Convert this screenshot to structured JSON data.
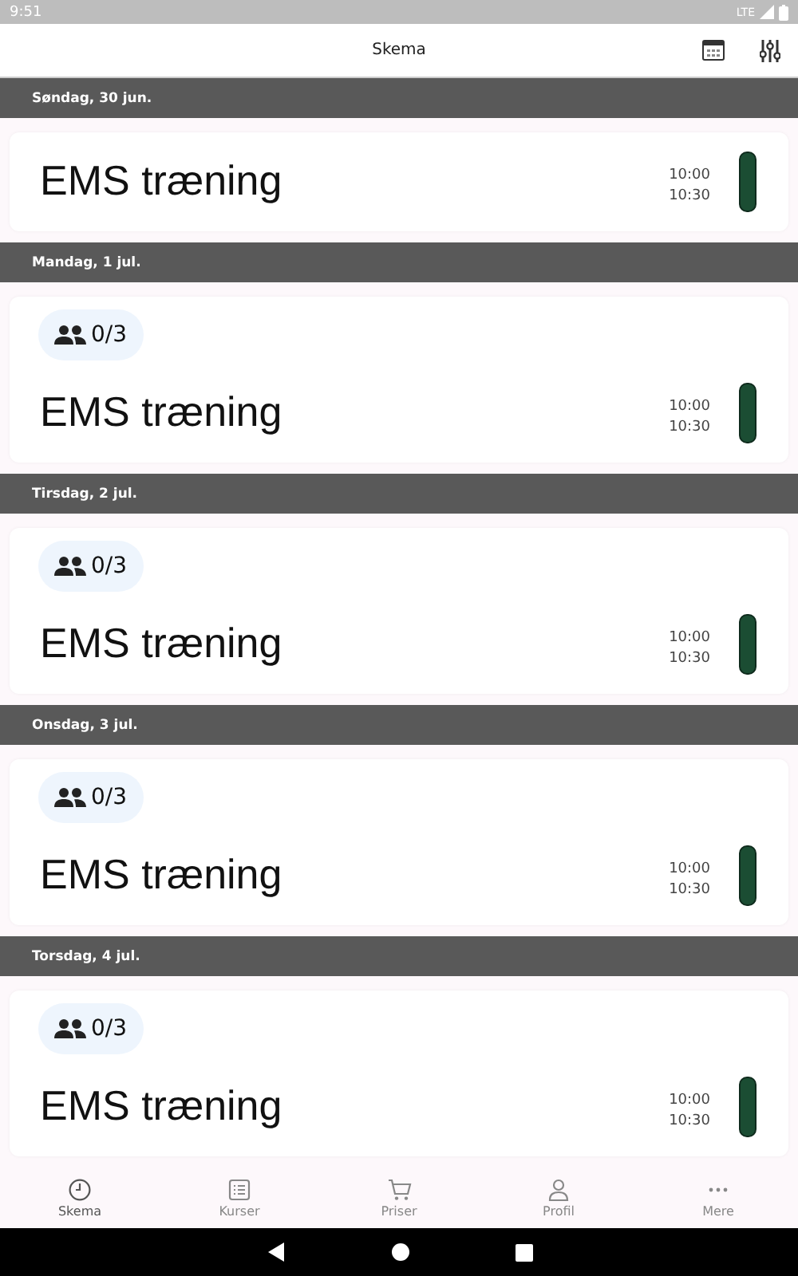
{
  "status_bar": {
    "time": "9:51",
    "network": "LTE"
  },
  "app_bar": {
    "title": "Skema"
  },
  "days": [
    {
      "date": "Søndag, 30 jun.",
      "events": [
        {
          "title": "EMS træning",
          "start": "10:00",
          "end": "10:30"
        }
      ]
    },
    {
      "date": "Mandag, 1 jul.",
      "events": [
        {
          "title": "EMS træning",
          "start": "10:00",
          "end": "10:30",
          "participants": "0/3"
        }
      ]
    },
    {
      "date": "Tirsdag, 2 jul.",
      "events": [
        {
          "title": "EMS træning",
          "start": "10:00",
          "end": "10:30",
          "participants": "0/3"
        }
      ]
    },
    {
      "date": "Onsdag, 3 jul.",
      "events": [
        {
          "title": "EMS træning",
          "start": "10:00",
          "end": "10:30",
          "participants": "0/3"
        }
      ]
    },
    {
      "date": "Torsdag, 4 jul.",
      "events": [
        {
          "title": "EMS træning",
          "start": "10:00",
          "end": "10:30",
          "participants": "0/3"
        }
      ]
    }
  ],
  "bottom_nav": [
    {
      "label": "Skema",
      "selected": true
    },
    {
      "label": "Kurser",
      "selected": false
    },
    {
      "label": "Priser",
      "selected": false
    },
    {
      "label": "Profil",
      "selected": false
    },
    {
      "label": "Mere",
      "selected": false
    }
  ]
}
